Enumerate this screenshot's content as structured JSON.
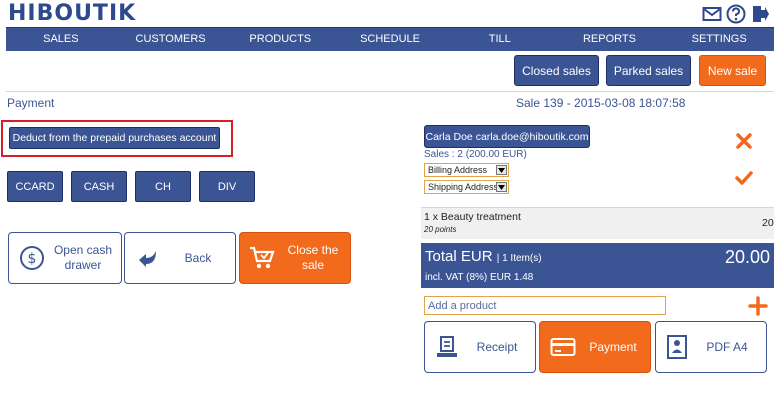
{
  "app": {
    "logo": "HIBOUTIK"
  },
  "colors": {
    "primary": "#3b5594",
    "accent": "#f26a1b",
    "highlight": "#d61f26"
  },
  "header_icons": [
    "mail-icon",
    "help-icon",
    "logout-icon"
  ],
  "nav": {
    "items": [
      {
        "label": "SALES"
      },
      {
        "label": "CUSTOMERS"
      },
      {
        "label": "PRODUCTS"
      },
      {
        "label": "SCHEDULE"
      },
      {
        "label": "TILL"
      },
      {
        "label": "REPORTS"
      },
      {
        "label": "SETTINGS"
      }
    ]
  },
  "subbar": {
    "closed_sales": "Closed sales",
    "parked_sales": "Parked sales",
    "new_sale": "New sale"
  },
  "payment": {
    "title": "Payment",
    "deduct_label": "Deduct from the prepaid purchases account",
    "methods": [
      {
        "label": "CCARD"
      },
      {
        "label": "CASH"
      },
      {
        "label": "CH"
      },
      {
        "label": "DIV"
      }
    ],
    "actions": {
      "open_drawer": "Open cash drawer",
      "back": "Back",
      "close_sale": "Close the sale"
    }
  },
  "sale": {
    "info": "Sale 139 - 2015-03-08 18:07:58",
    "customer": "Carla Doe carla.doe@hiboutik.com",
    "sales_count": "Sales : 2 (200.00 EUR)",
    "billing_address": "Billing Address",
    "shipping_address": "Shipping Address",
    "item": {
      "name": "1 x Beauty treatment",
      "points": "20 points",
      "price": "20"
    },
    "total_label": "Total EUR",
    "total_items": "| 1 Item(s)",
    "total_value": "20.00",
    "vat": "incl. VAT (8%) EUR 1.48",
    "add_product_placeholder": "Add a product",
    "docs": {
      "receipt": "Receipt",
      "payment": "Payment",
      "pdf": "PDF A4"
    }
  }
}
